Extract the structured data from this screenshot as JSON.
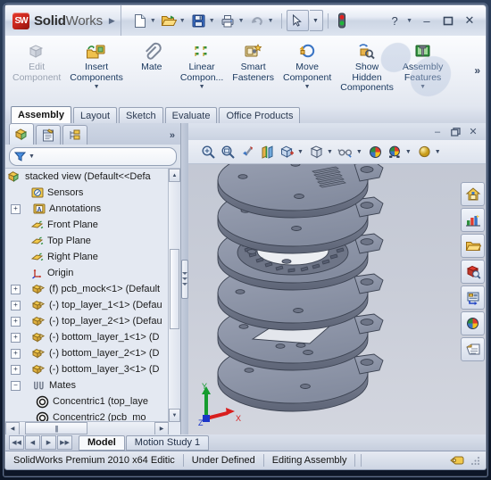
{
  "app": {
    "brand_primary": "SolidWorks",
    "brand_sw": "Solid",
    "brand_works": "Works",
    "logo_text": "SW",
    "accent_red": "#c4231a",
    "accent_blue": "#17365d"
  },
  "titlebar": {
    "dropdown_arrow": "▶",
    "buttons": [
      {
        "name": "new-document-button",
        "icon": "new-file-icon",
        "caret": true
      },
      {
        "name": "open-document-button",
        "icon": "open-folder-icon",
        "caret": true
      },
      {
        "name": "save-button",
        "icon": "floppy-disk-icon",
        "caret": true
      },
      {
        "name": "print-button",
        "icon": "printer-icon",
        "caret": true
      },
      {
        "name": "undo-button",
        "icon": "undo-arrow-icon",
        "caret": true
      }
    ],
    "select_tool": "cursor-arrow-icon",
    "rebuild_icon": "traffic-light-icon",
    "help_label": "?",
    "minimize": "–",
    "maximize": "❐",
    "close": "✕"
  },
  "ribbon": {
    "commands": [
      {
        "label1": "Edit",
        "label2": "Component",
        "icon": "edit-component-icon",
        "dropdown": false,
        "dimmed": true
      },
      {
        "label1": "Insert",
        "label2": "Components",
        "icon": "insert-components-icon",
        "dropdown": true,
        "dimmed": false
      },
      {
        "label1": "Mate",
        "label2": "",
        "icon": "mate-paperclip-icon",
        "dropdown": false,
        "dimmed": false
      },
      {
        "label1": "Linear",
        "label2": "Compon...",
        "icon": "linear-component-pattern-icon",
        "dropdown": true,
        "dimmed": false
      },
      {
        "label1": "Smart",
        "label2": "Fasteners",
        "icon": "smart-fasteners-icon",
        "dropdown": false,
        "dimmed": false
      },
      {
        "label1": "Move",
        "label2": "Component",
        "icon": "move-component-icon",
        "dropdown": true,
        "dimmed": false
      },
      {
        "label1": "Show",
        "label2": "Hidden",
        "label3": "Components",
        "icon": "show-hidden-components-icon",
        "dropdown": false,
        "dimmed": false
      },
      {
        "label1": "Assembly",
        "label2": "Features",
        "icon": "assembly-features-icon",
        "dropdown": true,
        "dimmed": false
      }
    ],
    "overflow": "»"
  },
  "tabs": [
    {
      "label": "Assembly",
      "active": true
    },
    {
      "label": "Layout",
      "active": false
    },
    {
      "label": "Sketch",
      "active": false
    },
    {
      "label": "Evaluate",
      "active": false
    },
    {
      "label": "Office Products",
      "active": false
    }
  ],
  "feature_manager": {
    "tabs": [
      {
        "name": "feature-manager-tab",
        "icon": "feature-tree-icon",
        "active": true
      },
      {
        "name": "property-manager-tab",
        "icon": "property-manager-icon",
        "active": false
      },
      {
        "name": "configuration-manager-tab",
        "icon": "configuration-manager-icon",
        "active": false
      }
    ],
    "overflow": "»",
    "filter_placeholder": "",
    "filter_icon": "filter-funnel-icon",
    "root": {
      "label": "stacked view  (Default<<Defa",
      "icon": "assembly-icon"
    },
    "items": [
      {
        "label": "Sensors",
        "icon": "sensors-icon",
        "indent": 1,
        "expand": "none"
      },
      {
        "label": "Annotations",
        "icon": "annotations-icon",
        "indent": 1,
        "expand": "plus"
      },
      {
        "label": "Front Plane",
        "icon": "plane-icon",
        "indent": 1,
        "expand": "none"
      },
      {
        "label": "Top Plane",
        "icon": "plane-icon",
        "indent": 1,
        "expand": "none"
      },
      {
        "label": "Right Plane",
        "icon": "plane-icon",
        "indent": 1,
        "expand": "none"
      },
      {
        "label": "Origin",
        "icon": "origin-icon",
        "indent": 1,
        "expand": "none"
      },
      {
        "label": "(f) pcb_mock<1> (Default",
        "icon": "component-icon",
        "indent": 1,
        "expand": "plus"
      },
      {
        "label": "(-) top_layer_1<1> (Defau",
        "icon": "component-icon",
        "indent": 1,
        "expand": "plus"
      },
      {
        "label": "(-) top_layer_2<1> (Defau",
        "icon": "component-icon",
        "indent": 1,
        "expand": "plus"
      },
      {
        "label": "(-) bottom_layer_1<1> (D",
        "icon": "component-icon",
        "indent": 1,
        "expand": "plus"
      },
      {
        "label": "(-) bottom_layer_2<1> (D",
        "icon": "component-icon",
        "indent": 1,
        "expand": "plus"
      },
      {
        "label": "(-) bottom_layer_3<1> (D",
        "icon": "component-icon",
        "indent": 1,
        "expand": "plus"
      },
      {
        "label": "Mates",
        "icon": "mates-folder-icon",
        "indent": 1,
        "expand": "minus"
      },
      {
        "label": "Concentric1 (top_laye",
        "icon": "concentric-mate-icon",
        "indent": 2,
        "expand": "none"
      },
      {
        "label": "Concentric2 (pcb_mo",
        "icon": "concentric-mate-icon",
        "indent": 2,
        "expand": "none"
      }
    ],
    "hscroll_grip": "|||"
  },
  "graphics": {
    "window_minimize": "–",
    "window_restore": "❐",
    "window_close": "✕",
    "view_toolbar": [
      {
        "name": "zoom-to-fit-button",
        "icon": "zoom-to-fit-icon",
        "caret": false
      },
      {
        "name": "zoom-to-area-button",
        "icon": "zoom-to-area-icon",
        "caret": false
      },
      {
        "name": "previous-view-button",
        "icon": "previous-view-icon",
        "caret": false
      },
      {
        "name": "section-view-button",
        "icon": "section-view-icon",
        "caret": false
      },
      {
        "name": "view-orientation-button",
        "icon": "view-orientation-icon",
        "caret": true
      },
      {
        "name": "display-style-button",
        "icon": "display-style-cube-icon",
        "caret": true
      },
      {
        "name": "hide-show-items-button",
        "icon": "eyeglasses-icon",
        "caret": true
      },
      {
        "name": "edit-appearance-button",
        "icon": "appearance-sphere-icon",
        "caret": false
      },
      {
        "name": "apply-scene-button",
        "icon": "scene-sphere-icon",
        "caret": true
      },
      {
        "name": "view-settings-button",
        "icon": "shadow-sphere-icon",
        "caret": true
      }
    ],
    "right_toolbar": [
      {
        "name": "view-home-button",
        "icon": "home-house-icon"
      },
      {
        "name": "display-manager-button",
        "icon": "display-manager-icon"
      },
      {
        "name": "open-folder-button",
        "icon": "open-folder-icon"
      },
      {
        "name": "appearances-button",
        "icon": "appearance-ball-icon"
      },
      {
        "name": "custom-properties-button",
        "icon": "custom-properties-icon"
      },
      {
        "name": "scenes-button",
        "icon": "scenes-ball-icon"
      },
      {
        "name": "decals-button",
        "icon": "decals-note-icon"
      }
    ],
    "triad": {
      "x_label": "X",
      "y_label": "Y",
      "z_label": "Z",
      "x_color": "#d81e1e",
      "y_color": "#159c2e",
      "z_color": "#1a35c8"
    },
    "model_description": "exploded stack of six circular PCB layers"
  },
  "bottom_tabs": {
    "nav": [
      "⏮",
      "◀",
      "▶",
      "⏭"
    ],
    "tabs": [
      {
        "label": "Model",
        "active": true
      },
      {
        "label": "Motion Study 1",
        "active": false
      }
    ]
  },
  "statusbar": {
    "product": "SolidWorks Premium 2010 x64 Editic",
    "state": "Under Defined",
    "mode": "Editing Assembly",
    "icon": "tag-icon"
  }
}
